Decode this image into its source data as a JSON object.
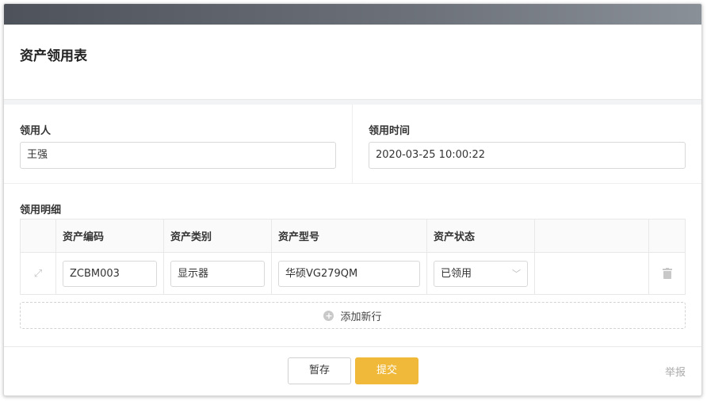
{
  "form": {
    "title": "资产领用表"
  },
  "fields": {
    "receiver": {
      "label": "领用人",
      "value": "王强"
    },
    "receive_time": {
      "label": "领用时间",
      "value": "2020-03-25 10:00:22"
    }
  },
  "details": {
    "label": "领用明细",
    "columns": [
      "资产编码",
      "资产类别",
      "资产型号",
      "资产状态"
    ],
    "rows": [
      {
        "code": "ZCBM003",
        "category": "显示器",
        "model": "华硕VG279QM",
        "status": "已领用"
      }
    ],
    "add_row_label": "添加新行"
  },
  "footer": {
    "save_label": "暂存",
    "submit_label": "提交",
    "report_label": "举报"
  },
  "colors": {
    "accent": "#f0b93a",
    "topbar": "#5a5e66"
  },
  "icons": {
    "drag": "expand-arrows-icon",
    "delete": "trash-icon",
    "add": "plus-circle-icon",
    "select": "chevron-down-icon"
  }
}
